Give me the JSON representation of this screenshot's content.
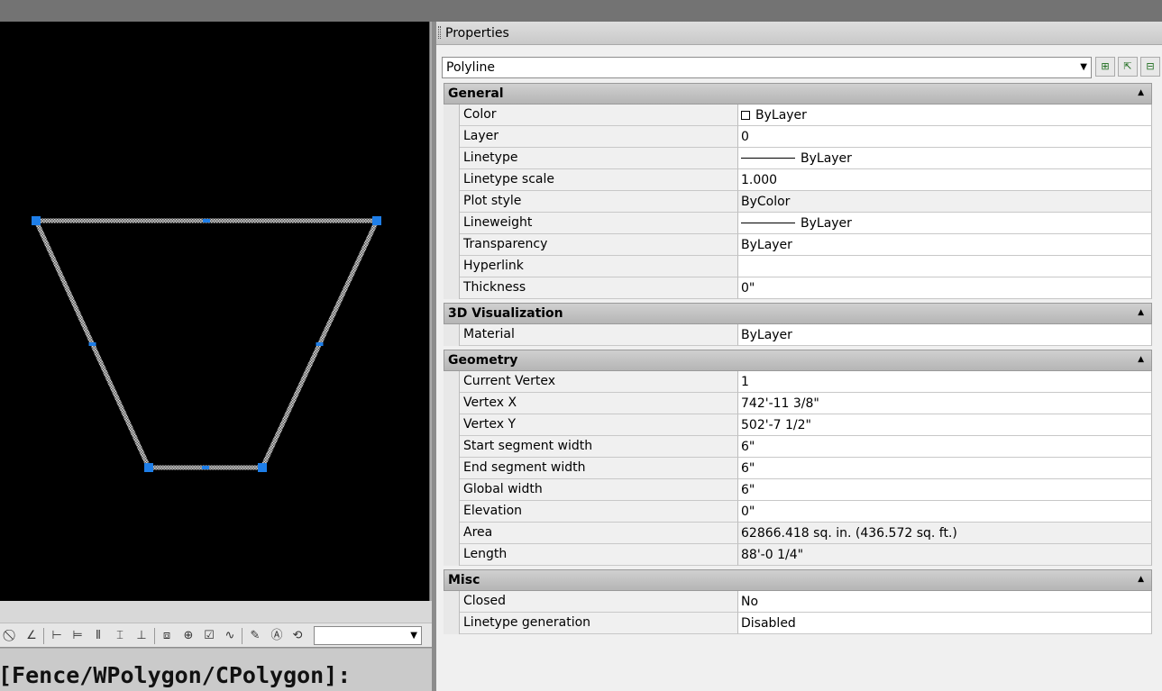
{
  "palette": {
    "title": "Properties",
    "object_type": "Polyline",
    "sections": [
      {
        "title": "General",
        "rows": [
          {
            "name": "Color",
            "value": "ByLayer",
            "swatch": "#ffffff"
          },
          {
            "name": "Layer",
            "value": "0"
          },
          {
            "name": "Linetype",
            "value": "ByLayer",
            "line": true
          },
          {
            "name": "Linetype scale",
            "value": "1.000"
          },
          {
            "name": "Plot style",
            "value": "ByColor",
            "readonly": true
          },
          {
            "name": "Lineweight",
            "value": "ByLayer",
            "line": true
          },
          {
            "name": "Transparency",
            "value": "ByLayer"
          },
          {
            "name": "Hyperlink",
            "value": ""
          },
          {
            "name": "Thickness",
            "value": "0\""
          }
        ]
      },
      {
        "title": "3D Visualization",
        "rows": [
          {
            "name": "Material",
            "value": "ByLayer"
          }
        ]
      },
      {
        "title": "Geometry",
        "rows": [
          {
            "name": "Current Vertex",
            "value": "1"
          },
          {
            "name": "Vertex X",
            "value": "742'-11 3/8\""
          },
          {
            "name": "Vertex Y",
            "value": "502'-7 1/2\""
          },
          {
            "name": "Start segment width",
            "value": "6\""
          },
          {
            "name": "End segment width",
            "value": "6\""
          },
          {
            "name": "Global width",
            "value": "6\""
          },
          {
            "name": "Elevation",
            "value": "0\""
          },
          {
            "name": "Area",
            "value": "62866.418 sq. in. (436.572 sq. ft.)",
            "readonly": true
          },
          {
            "name": "Length",
            "value": "88'-0 1/4\"",
            "readonly": true
          }
        ]
      },
      {
        "title": "Misc",
        "rows": [
          {
            "name": "Closed",
            "value": "No"
          },
          {
            "name": "Linetype generation",
            "value": "Disabled"
          }
        ]
      }
    ]
  },
  "command_line": "[Fence/WPolygon/CPolygon]:",
  "colors": {
    "grip": "#1e7ee8",
    "canvas": "#000000",
    "polyline": "#c8c8c8"
  },
  "icons": {
    "toolbar": [
      "no-snap-icon",
      "angle-icon",
      "dim-linear-icon",
      "dim-aligned-icon",
      "dim-baseline-icon",
      "dim-continue-icon",
      "dim-ordinate-icon",
      "dim-break-icon",
      "dim-center-icon",
      "dim-inspect-icon",
      "dim-jog-icon",
      "dim-edit-icon",
      "dim-text-edit-icon",
      "dim-update-icon"
    ],
    "palette_buttons": [
      "quick-select-icon",
      "select-objects-icon",
      "toggle-pickadd-icon"
    ]
  }
}
